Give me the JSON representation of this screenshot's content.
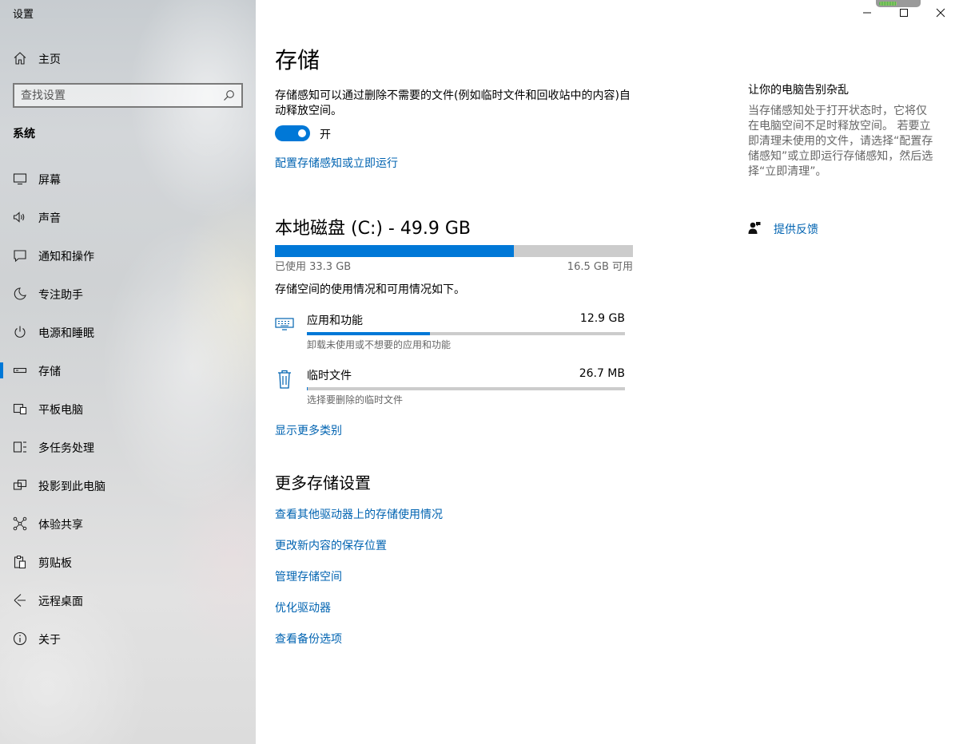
{
  "window": {
    "title": "设置",
    "controls": {
      "minimize": "minimize-icon",
      "maximize": "maximize-icon",
      "close": "close-icon"
    }
  },
  "sidebar": {
    "home_label": "主页",
    "search_placeholder": "查找设置",
    "section_label": "系统",
    "selected_index": 5,
    "items": [
      {
        "label": "屏幕",
        "icon": "display-icon"
      },
      {
        "label": "声音",
        "icon": "speaker-icon"
      },
      {
        "label": "通知和操作",
        "icon": "notification-icon"
      },
      {
        "label": "专注助手",
        "icon": "moon-icon"
      },
      {
        "label": "电源和睡眠",
        "icon": "power-icon"
      },
      {
        "label": "存储",
        "icon": "storage-icon"
      },
      {
        "label": "平板电脑",
        "icon": "tablet-icon"
      },
      {
        "label": "多任务处理",
        "icon": "multitask-icon"
      },
      {
        "label": "投影到此电脑",
        "icon": "project-icon"
      },
      {
        "label": "体验共享",
        "icon": "share-icon"
      },
      {
        "label": "剪贴板",
        "icon": "clipboard-icon"
      },
      {
        "label": "远程桌面",
        "icon": "remote-desktop-icon"
      },
      {
        "label": "关于",
        "icon": "info-icon"
      }
    ]
  },
  "main": {
    "title": "存储",
    "storage_sense": {
      "description": "存储感知可以通过删除不需要的文件(例如临时文件和回收站中的内容)自动释放空间。",
      "toggle_on": true,
      "toggle_label": "开",
      "configure_link": "配置存储感知或立即运行"
    },
    "disk": {
      "title": "本地磁盘 (C:) - 49.9 GB",
      "used_fraction": 0.667,
      "used_label": "已使用 33.3 GB",
      "free_label": "16.5 GB 可用",
      "usage_description": "存储空间的使用情况和可用情况如下。",
      "categories": [
        {
          "name": "应用和功能",
          "size": "12.9 GB",
          "fraction": 0.387,
          "subtitle": "卸载未使用或不想要的应用和功能",
          "icon": "apps-icon"
        },
        {
          "name": "临时文件",
          "size": "26.7 MB",
          "fraction": 0.001,
          "subtitle": "选择要删除的临时文件",
          "icon": "trash-icon"
        }
      ],
      "show_more_link": "显示更多类别"
    },
    "more_settings": {
      "title": "更多存储设置",
      "links": [
        "查看其他驱动器上的存储使用情况",
        "更改新内容的保存位置",
        "管理存储空间",
        "优化驱动器",
        "查看备份选项"
      ]
    }
  },
  "aside": {
    "title": "让你的电脑告别杂乱",
    "description": "当存储感知处于打开状态时，它将仅在电脑空间不足时释放空间。 若要立即清理未使用的文件，请选择“配置存储感知”或立即运行存储感知，然后选择“立即清理”。",
    "feedback_label": "提供反馈",
    "feedback_icon": "feedback-icon"
  },
  "colors": {
    "accent": "#0078d7",
    "link": "#0063b1",
    "bar_track": "#cccccc",
    "secondary_text": "#666666"
  }
}
